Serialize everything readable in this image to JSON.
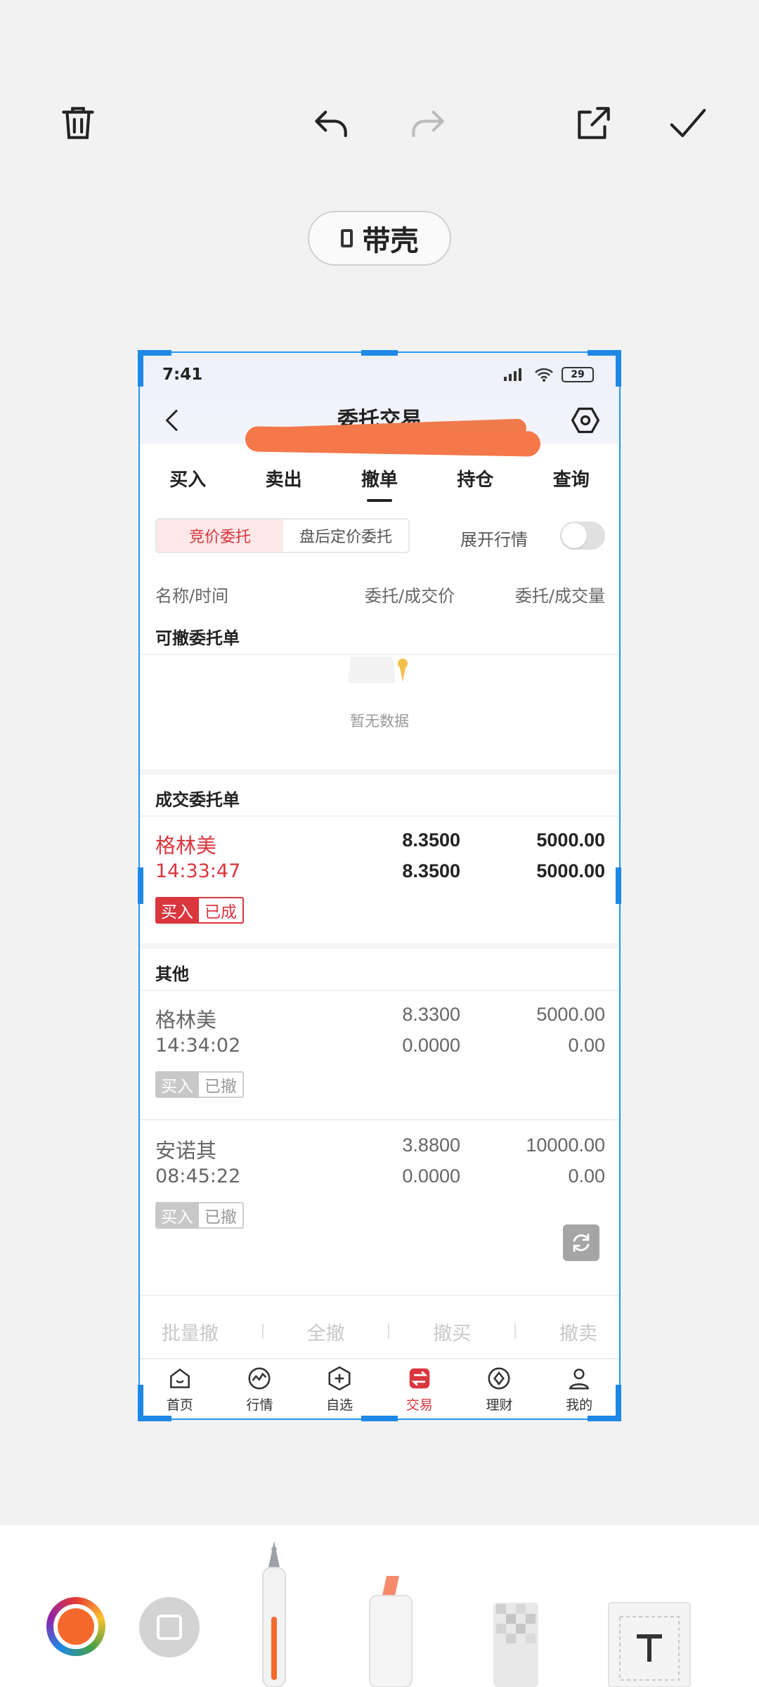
{
  "editor": {
    "frame_label": "带壳"
  },
  "app": {
    "status_time": "7:41",
    "battery": "29",
    "title": "委托交易",
    "tabs": [
      "买入",
      "卖出",
      "撤单",
      "持仓",
      "查询"
    ],
    "segment": [
      "竞价委托",
      "盘后定价委托"
    ],
    "expand_label": "展开行情",
    "columns": [
      "名称/时间",
      "委托/成交价",
      "委托/成交量"
    ],
    "sections": {
      "cancelable": "可撤委托单",
      "empty": "暂无数据",
      "filled": "成交委托单",
      "other": "其他"
    },
    "filled_orders": [
      {
        "name": "格林美",
        "time": "14:33:47",
        "price": "8.3500",
        "deal_price": "8.3500",
        "qty": "5000.00",
        "deal_qty": "5000.00",
        "side": "买入",
        "status": "已成"
      }
    ],
    "other_orders": [
      {
        "name": "格林美",
        "time": "14:34:02",
        "price": "8.3300",
        "deal_price": "0.0000",
        "qty": "5000.00",
        "deal_qty": "0.00",
        "side": "买入",
        "status": "已撤"
      },
      {
        "name": "安诺其",
        "time": "08:45:22",
        "price": "3.8800",
        "deal_price": "0.0000",
        "qty": "10000.00",
        "deal_qty": "0.00",
        "side": "买入",
        "status": "已撤"
      }
    ],
    "actions": [
      "批量撤",
      "全撤",
      "撤买",
      "撤卖"
    ],
    "nav": [
      "首页",
      "行情",
      "自选",
      "交易",
      "理财",
      "我的"
    ]
  },
  "colors": {
    "accent_red": "#d9363e",
    "selection_blue": "#1e88e5",
    "brush_orange": "#f56a2c"
  }
}
